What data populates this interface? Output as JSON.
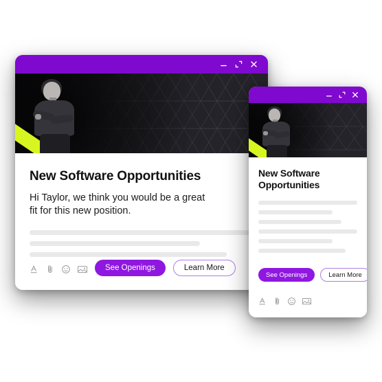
{
  "scene": {
    "background_color": "#ffffff",
    "description": "Two overlapping email-composer preview windows"
  },
  "theme": {
    "brand_purple": "#7f09ce",
    "button_purple": "#8f17e0",
    "accent_lime": "#d7f521",
    "hero_dark": "#242329",
    "skeleton_gray": "#e9e9e9",
    "title_color": "#111111"
  },
  "windows": [
    {
      "id": "window-large",
      "name": "primary-preview-window",
      "titlebar": {
        "color": "#7f09ce",
        "controls": [
          {
            "name": "minimize-button",
            "icon": "minimize-icon",
            "label": "Minimize"
          },
          {
            "name": "maximize-button",
            "icon": "maximize-icon",
            "label": "Maximize"
          },
          {
            "name": "close-button",
            "icon": "close-icon",
            "label": "Close"
          }
        ]
      },
      "hero": {
        "name": "hero-banner",
        "alt": "Person with crossed arms in front of dark geometric triangle pattern with lime diagonal stripe",
        "stripe_color": "#d7f521"
      },
      "title": "New Software Opportunities",
      "subtitle": "Hi Taylor, we think you would be a great fit for this new position.",
      "skeleton_widths": [
        "100%",
        "76%",
        "88%"
      ],
      "buttons": {
        "primary_label": "See Openings",
        "secondary_label": "Learn More"
      },
      "toolbar_icons": [
        {
          "name": "text-format-icon",
          "label": "Text formatting"
        },
        {
          "name": "attachment-icon",
          "label": "Attach file"
        },
        {
          "name": "emoji-icon",
          "label": "Insert emoji"
        },
        {
          "name": "image-icon",
          "label": "Insert image"
        }
      ]
    },
    {
      "id": "window-small",
      "name": "secondary-preview-window",
      "titlebar": {
        "color": "#7f09ce",
        "controls": [
          {
            "name": "minimize-button",
            "icon": "minimize-icon",
            "label": "Minimize"
          },
          {
            "name": "maximize-button",
            "icon": "maximize-icon",
            "label": "Maximize"
          },
          {
            "name": "close-button",
            "icon": "close-icon",
            "label": "Close"
          }
        ]
      },
      "hero": {
        "name": "hero-banner",
        "alt": "Person with crossed arms in front of dark geometric triangle pattern with lime diagonal stripe",
        "stripe_color": "#d7f521"
      },
      "title": "New Software Opportunities",
      "subtitle": "",
      "skeleton_widths": [
        "100%",
        "75%",
        "84%",
        "100%",
        "75%",
        "88%"
      ],
      "buttons": {
        "primary_label": "See Openings",
        "secondary_label": "Learn More"
      },
      "toolbar_icons": [
        {
          "name": "text-format-icon",
          "label": "Text formatting"
        },
        {
          "name": "attachment-icon",
          "label": "Attach file"
        },
        {
          "name": "emoji-icon",
          "label": "Insert emoji"
        },
        {
          "name": "image-icon",
          "label": "Insert image"
        }
      ]
    }
  ]
}
